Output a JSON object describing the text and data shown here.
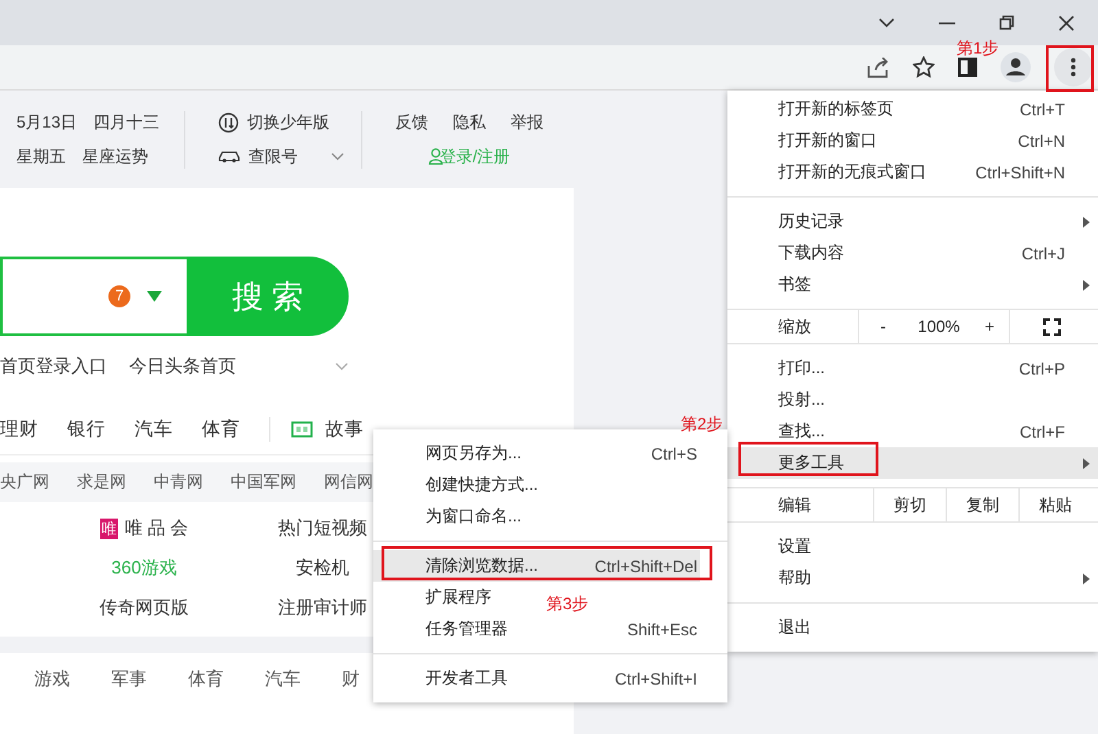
{
  "header": {
    "date": "5月13日",
    "lunar": "四月十三",
    "weekday": "星期五",
    "horoscope": "星座运势",
    "youth_mode": "切换少年版",
    "plate_limit": "查限号",
    "links": [
      "反馈",
      "隐私",
      "举报"
    ],
    "login": "登录/注册"
  },
  "search": {
    "badge": "7",
    "button": "搜索"
  },
  "search_links": [
    "首页登录入口",
    "今日头条首页"
  ],
  "nav": [
    {
      "label": "理财",
      "kind": "text"
    },
    {
      "label": "银行",
      "kind": "text"
    },
    {
      "label": "汽车",
      "kind": "text"
    },
    {
      "label": "体育",
      "kind": "text"
    },
    {
      "label": "故事",
      "kind": "icon"
    }
  ],
  "site_links": [
    "央广网",
    "求是网",
    "中青网",
    "中国军网",
    "网信网"
  ],
  "grid": [
    [
      {
        "label": "唯 品 会",
        "kind": "logo",
        "logo": "唯"
      },
      {
        "label": "热门短视频",
        "kind": "text"
      }
    ],
    [
      {
        "label": "360游戏",
        "kind": "green"
      },
      {
        "label": "安检机",
        "kind": "text"
      }
    ],
    [
      {
        "label": "传奇网页版",
        "kind": "text"
      },
      {
        "label": "注册审计师",
        "kind": "text"
      }
    ]
  ],
  "news_tabs": [
    "游戏",
    "军事",
    "体育",
    "汽车",
    "财"
  ],
  "main_menu": {
    "groups": [
      {
        "items": [
          {
            "kind": "item",
            "label": "打开新的标签页",
            "shortcut": "Ctrl+T",
            "submenu": false,
            "selected": false
          },
          {
            "kind": "item",
            "label": "打开新的窗口",
            "shortcut": "Ctrl+N",
            "submenu": false,
            "selected": false
          },
          {
            "kind": "item",
            "label": "打开新的无痕式窗口",
            "shortcut": "Ctrl+Shift+N",
            "submenu": false,
            "selected": false
          }
        ]
      },
      {
        "items": [
          {
            "kind": "item",
            "label": "历史记录",
            "submenu": true,
            "selected": false
          },
          {
            "kind": "item",
            "label": "下载内容",
            "shortcut": "Ctrl+J",
            "submenu": false,
            "selected": false
          },
          {
            "kind": "item",
            "label": "书签",
            "submenu": true,
            "selected": false
          }
        ]
      },
      {
        "items": [
          {
            "kind": "zoom",
            "label": "缩放",
            "minus": "-",
            "value": "100%",
            "plus": "+"
          }
        ]
      },
      {
        "items": [
          {
            "kind": "item",
            "label": "打印...",
            "shortcut": "Ctrl+P",
            "submenu": false,
            "selected": false
          },
          {
            "kind": "item",
            "label": "投射...",
            "submenu": false,
            "selected": false
          },
          {
            "kind": "item",
            "label": "查找...",
            "shortcut": "Ctrl+F",
            "submenu": false,
            "selected": false
          },
          {
            "kind": "item",
            "label": "更多工具",
            "submenu": true,
            "selected": true
          }
        ]
      },
      {
        "items": [
          {
            "kind": "edit",
            "label": "编辑",
            "actions": [
              "剪切",
              "复制",
              "粘贴"
            ]
          }
        ]
      },
      {
        "items": [
          {
            "kind": "item",
            "label": "设置",
            "submenu": false,
            "selected": false
          },
          {
            "kind": "item",
            "label": "帮助",
            "submenu": true,
            "selected": false
          }
        ]
      },
      {
        "items": [
          {
            "kind": "item",
            "label": "退出",
            "submenu": false,
            "selected": false
          }
        ]
      }
    ]
  },
  "sub_menu": {
    "groups": [
      {
        "items": [
          {
            "kind": "item",
            "label": "网页另存为...",
            "shortcut": "Ctrl+S",
            "submenu": false,
            "selected": false
          },
          {
            "kind": "item",
            "label": "创建快捷方式...",
            "submenu": false,
            "selected": false
          },
          {
            "kind": "item",
            "label": "为窗口命名...",
            "submenu": false,
            "selected": false
          }
        ]
      },
      {
        "items": [
          {
            "kind": "item",
            "label": "清除浏览数据...",
            "shortcut": "Ctrl+Shift+Del",
            "submenu": false,
            "selected": true
          },
          {
            "kind": "item",
            "label": "扩展程序",
            "submenu": false,
            "selected": false
          },
          {
            "kind": "item",
            "label": "任务管理器",
            "shortcut": "Shift+Esc",
            "submenu": false,
            "selected": false
          }
        ]
      },
      {
        "items": [
          {
            "kind": "item",
            "label": "开发者工具",
            "shortcut": "Ctrl+Shift+I",
            "submenu": false,
            "selected": false
          }
        ]
      }
    ]
  },
  "annotations": [
    {
      "text": "第1步"
    },
    {
      "text": "第2步"
    },
    {
      "text": "第3步"
    }
  ]
}
